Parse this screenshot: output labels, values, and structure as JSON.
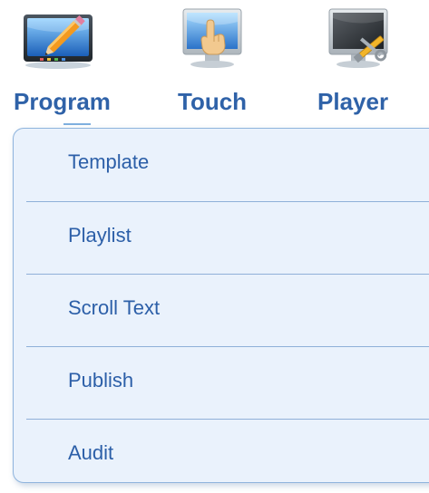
{
  "nav": {
    "items": [
      {
        "label": "Program",
        "icon": "program-screen-pencil-icon",
        "active": true
      },
      {
        "label": "Touch",
        "icon": "touch-monitor-hand-icon"
      },
      {
        "label": "Player",
        "icon": "player-monitor-tools-icon"
      }
    ]
  },
  "dropdown": {
    "items": [
      {
        "label": "Template"
      },
      {
        "label": "Playlist"
      },
      {
        "label": "Scroll Text"
      },
      {
        "label": "Publish"
      },
      {
        "label": "Audit"
      }
    ]
  },
  "colors": {
    "nav_label": "#2f62a8",
    "menu_label": "#2c5fa8",
    "menu_background": "#eaf2fc",
    "menu_border": "#8fb4dd"
  }
}
